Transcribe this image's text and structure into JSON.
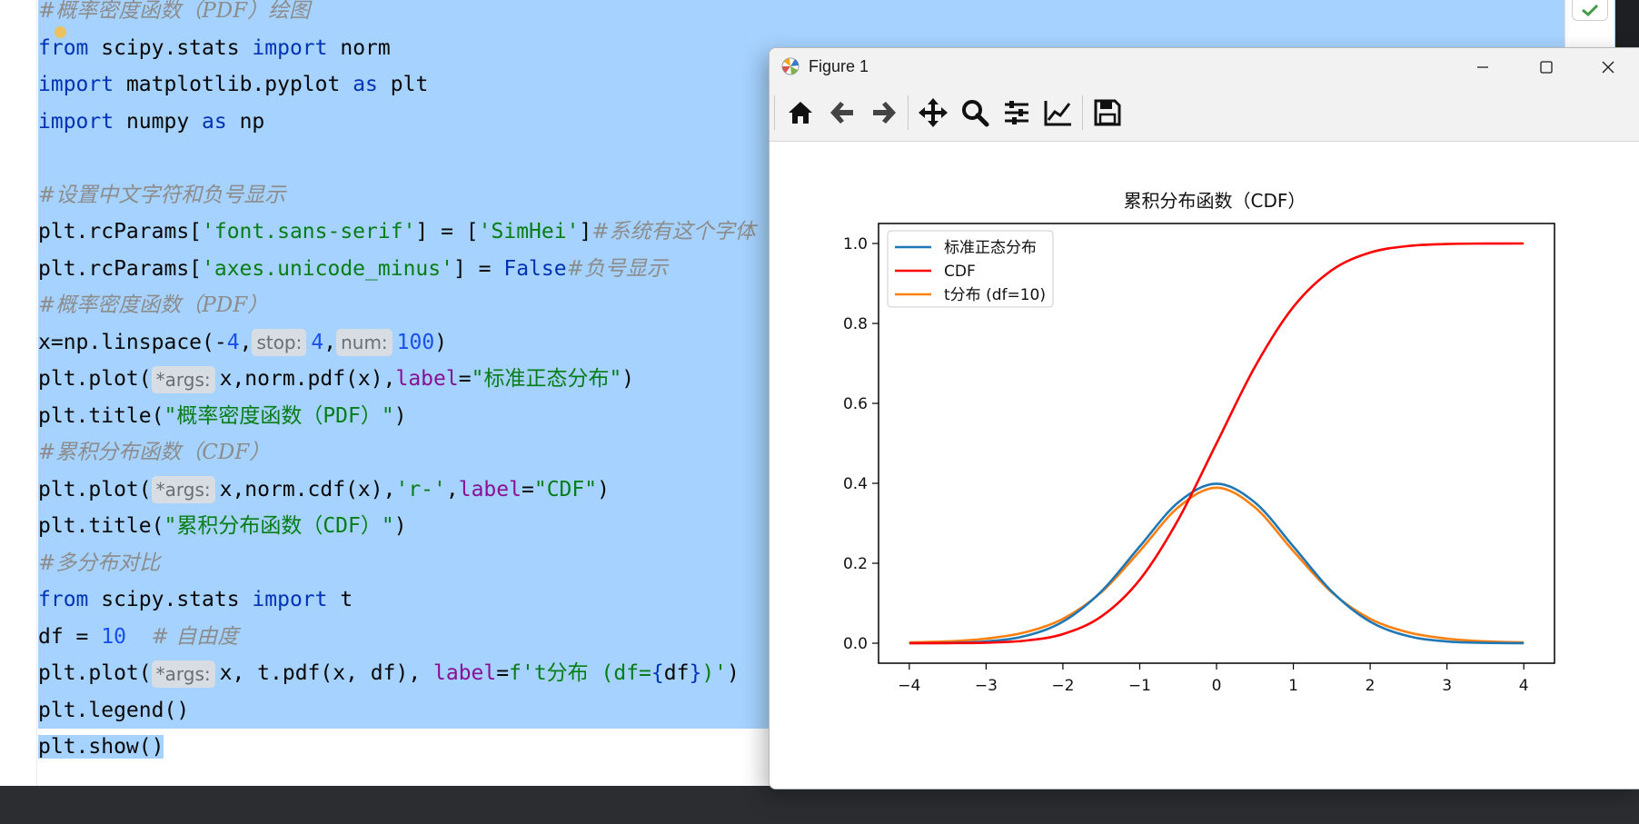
{
  "editor": {
    "lines": [
      {
        "sel": true,
        "tokens": [
          {
            "c": "cmt",
            "t": "#概率密度函数（PDF）绘图"
          }
        ]
      },
      {
        "sel": true,
        "tokens": [
          {
            "c": "kw",
            "t": "from"
          },
          {
            "c": "",
            "t": " scipy.stats "
          },
          {
            "c": "kw",
            "t": "import"
          },
          {
            "c": "",
            "t": " norm"
          }
        ]
      },
      {
        "sel": true,
        "tokens": [
          {
            "c": "kw",
            "t": "import"
          },
          {
            "c": "",
            "t": " matplotlib.pyplot "
          },
          {
            "c": "kw",
            "t": "as"
          },
          {
            "c": "",
            "t": " plt"
          }
        ]
      },
      {
        "sel": true,
        "tokens": [
          {
            "c": "kw",
            "t": "import"
          },
          {
            "c": "",
            "t": " numpy "
          },
          {
            "c": "kw",
            "t": "as"
          },
          {
            "c": "",
            "t": " np"
          }
        ]
      },
      {
        "sel": true,
        "tokens": []
      },
      {
        "sel": true,
        "tokens": [
          {
            "c": "cmt",
            "t": "#设置中文字符和负号显示"
          }
        ]
      },
      {
        "sel": true,
        "tokens": [
          {
            "c": "",
            "t": "plt.rcParams["
          },
          {
            "c": "str",
            "t": "'font.sans-serif'"
          },
          {
            "c": "",
            "t": "] = ["
          },
          {
            "c": "str",
            "t": "'SimHei'"
          },
          {
            "c": "",
            "t": "]"
          },
          {
            "c": "cmt",
            "t": "#系统有这个字体"
          }
        ]
      },
      {
        "sel": true,
        "tokens": [
          {
            "c": "",
            "t": "plt.rcParams["
          },
          {
            "c": "str",
            "t": "'axes.unicode_minus'"
          },
          {
            "c": "",
            "t": "] = "
          },
          {
            "c": "kw",
            "t": "False"
          },
          {
            "c": "cmt",
            "t": "#负号显示"
          }
        ]
      },
      {
        "sel": true,
        "tokens": [
          {
            "c": "cmt",
            "t": "#概率密度函数（PDF）"
          }
        ]
      },
      {
        "sel": true,
        "tokens": [
          {
            "c": "",
            "t": "x=np.linspace(-"
          },
          {
            "c": "num",
            "t": "4"
          },
          {
            "c": "",
            "t": ","
          },
          {
            "c": "hint",
            "t": "stop:"
          },
          {
            "c": "num",
            "t": "4"
          },
          {
            "c": "",
            "t": ","
          },
          {
            "c": "hint",
            "t": "num:"
          },
          {
            "c": "num",
            "t": "100"
          },
          {
            "c": "",
            "t": ")"
          }
        ]
      },
      {
        "sel": true,
        "tokens": [
          {
            "c": "",
            "t": "plt.plot("
          },
          {
            "c": "hint",
            "t": "*args:"
          },
          {
            "c": "",
            "t": "x,norm.pdf(x),"
          },
          {
            "c": "kwarg",
            "t": "label"
          },
          {
            "c": "",
            "t": "="
          },
          {
            "c": "str",
            "t": "\"标准正态分布\""
          },
          {
            "c": "",
            "t": ")"
          }
        ]
      },
      {
        "sel": true,
        "tokens": [
          {
            "c": "",
            "t": "plt.title("
          },
          {
            "c": "str",
            "t": "\"概率密度函数（PDF）\""
          },
          {
            "c": "",
            "t": ")"
          }
        ]
      },
      {
        "sel": true,
        "tokens": [
          {
            "c": "cmt",
            "t": "#累积分布函数（CDF）"
          }
        ]
      },
      {
        "sel": true,
        "tokens": [
          {
            "c": "",
            "t": "plt.plot("
          },
          {
            "c": "hint",
            "t": "*args:"
          },
          {
            "c": "",
            "t": "x,norm.cdf(x),"
          },
          {
            "c": "str",
            "t": "'r-'"
          },
          {
            "c": "",
            "t": ","
          },
          {
            "c": "kwarg",
            "t": "label"
          },
          {
            "c": "",
            "t": "="
          },
          {
            "c": "str",
            "t": "\"CDF\""
          },
          {
            "c": "",
            "t": ")"
          }
        ]
      },
      {
        "sel": true,
        "tokens": [
          {
            "c": "",
            "t": "plt.title("
          },
          {
            "c": "str",
            "t": "\"累积分布函数（CDF）\""
          },
          {
            "c": "",
            "t": ")"
          }
        ]
      },
      {
        "sel": true,
        "tokens": [
          {
            "c": "cmt",
            "t": "#多分布对比"
          }
        ]
      },
      {
        "sel": true,
        "tokens": [
          {
            "c": "kw",
            "t": "from"
          },
          {
            "c": "",
            "t": " scipy.stats "
          },
          {
            "c": "kw",
            "t": "import"
          },
          {
            "c": "",
            "t": " t"
          }
        ]
      },
      {
        "sel": true,
        "tokens": [
          {
            "c": "",
            "t": "df = "
          },
          {
            "c": "num",
            "t": "10"
          },
          {
            "c": "",
            "t": "  "
          },
          {
            "c": "cmt",
            "t": "# 自由度"
          }
        ]
      },
      {
        "sel": true,
        "tokens": [
          {
            "c": "",
            "t": "plt.plot("
          },
          {
            "c": "hint",
            "t": "*args:"
          },
          {
            "c": "",
            "t": "x, t.pdf(x, df), "
          },
          {
            "c": "kwarg",
            "t": "label"
          },
          {
            "c": "",
            "t": "="
          },
          {
            "c": "str",
            "t": "f't分布 (df="
          },
          {
            "c": "kw",
            "t": "{"
          },
          {
            "c": "",
            "t": "df"
          },
          {
            "c": "kw",
            "t": "}"
          },
          {
            "c": "str",
            "t": ")'"
          },
          {
            "c": "",
            "t": ")"
          }
        ]
      },
      {
        "sel": true,
        "tokens": [
          {
            "c": "",
            "t": "plt.legend()"
          }
        ]
      },
      {
        "sel": "partial",
        "tokens": [
          {
            "c": "",
            "t": "plt.show()"
          }
        ]
      }
    ]
  },
  "figure": {
    "window_title": "Figure 1",
    "app_icon": "matplotlib-icon",
    "window_controls": [
      "minimize-icon",
      "maximize-icon",
      "close-icon"
    ],
    "toolbar": [
      "home-icon",
      "back-arrow-icon",
      "forward-arrow-icon",
      "pan-move-icon",
      "zoom-magnifier-icon",
      "configure-subplots-icon",
      "edit-axis-icon",
      "save-floppy-icon"
    ]
  },
  "chart_data": {
    "type": "line",
    "title": "累积分布函数（CDF）",
    "xlabel": "",
    "ylabel": "",
    "xlim": [
      -4.4,
      4.4
    ],
    "ylim": [
      -0.05,
      1.05
    ],
    "xticks": [
      -4,
      -3,
      -2,
      -1,
      0,
      1,
      2,
      3,
      4
    ],
    "xtick_labels": [
      "−4",
      "−3",
      "−2",
      "−1",
      "0",
      "1",
      "2",
      "3",
      "4"
    ],
    "yticks": [
      0.0,
      0.2,
      0.4,
      0.6,
      0.8,
      1.0
    ],
    "ytick_labels": [
      "0.0",
      "0.2",
      "0.4",
      "0.6",
      "0.8",
      "1.0"
    ],
    "grid": false,
    "legend_position": "upper-left",
    "series": [
      {
        "name": "标准正态分布",
        "color": "#1f77b4",
        "x": [
          -4,
          -3.5,
          -3,
          -2.5,
          -2,
          -1.5,
          -1,
          -0.5,
          0,
          0.5,
          1,
          1.5,
          2,
          2.5,
          3,
          3.5,
          4
        ],
        "y": [
          0.0001,
          0.0009,
          0.0044,
          0.0175,
          0.054,
          0.1295,
          0.242,
          0.3521,
          0.3989,
          0.3521,
          0.242,
          0.1295,
          0.054,
          0.0175,
          0.0044,
          0.0009,
          0.0001
        ]
      },
      {
        "name": "CDF",
        "color": "#ff0000",
        "x": [
          -4,
          -3.5,
          -3,
          -2.5,
          -2,
          -1.5,
          -1,
          -0.5,
          0,
          0.5,
          1,
          1.5,
          2,
          2.5,
          3,
          3.5,
          4
        ],
        "y": [
          0.0,
          0.0002,
          0.0013,
          0.0062,
          0.0228,
          0.0668,
          0.1587,
          0.3085,
          0.5,
          0.6915,
          0.8413,
          0.9332,
          0.9772,
          0.9938,
          0.9987,
          0.9998,
          1.0
        ]
      },
      {
        "name": "t分布 (df=10)",
        "color": "#ff7f0e",
        "x": [
          -4,
          -3.5,
          -3,
          -2.5,
          -2,
          -1.5,
          -1,
          -0.5,
          0,
          0.5,
          1,
          1.5,
          2,
          2.5,
          3,
          3.5,
          4
        ],
        "y": [
          0.002,
          0.0046,
          0.0114,
          0.0269,
          0.0611,
          0.1274,
          0.2304,
          0.3397,
          0.3891,
          0.3397,
          0.2304,
          0.1274,
          0.0611,
          0.0269,
          0.0114,
          0.0046,
          0.002
        ]
      }
    ]
  }
}
